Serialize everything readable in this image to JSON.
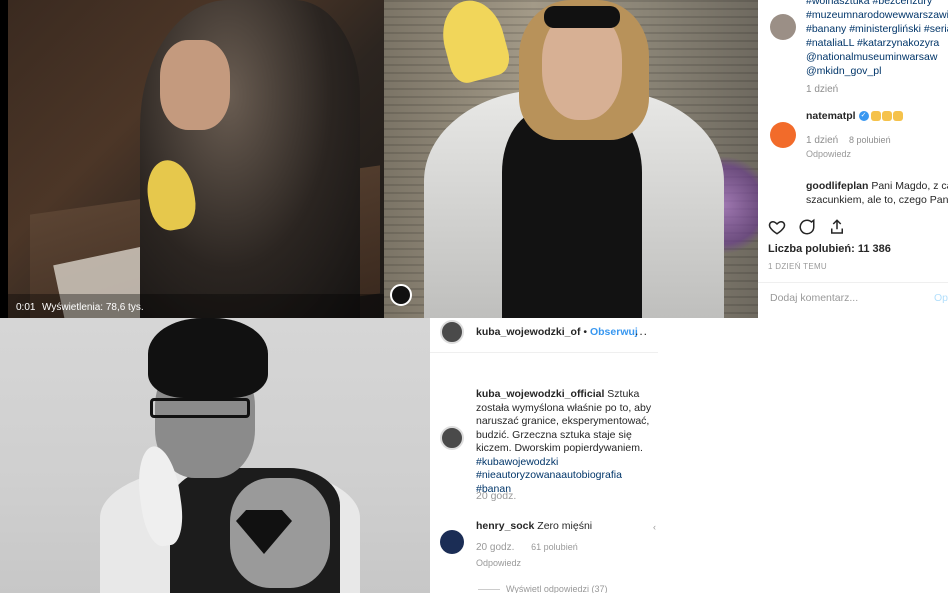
{
  "video": {
    "time": "0:01",
    "views": "Wyświetlenia: 78,6 tys."
  },
  "ig_top": {
    "hashtags": [
      "#wolnasztuka #bezcenzury",
      "#muzeumnarodowewwarszawie",
      "#banany #ministergliński #seria",
      "#nataliaLL #katarzynakozyra",
      "@nationalmuseuminwarsaw",
      "@mkidn_gov_pl"
    ],
    "time1": "1 dzień",
    "comment1_user": "natematpl",
    "comment1_time": "1 dzień",
    "comment1_likes": "8 polubień",
    "comment1_reply": "Odpowiedz",
    "comment2_user": "goodlifeplan",
    "comment2_text": "Pani Magdo, z ca",
    "comment2_text2": "szacunkiem, ale to, czego Pani",
    "likes": "Liczba polubień: 11 386",
    "ago": "1 DZIEŃ TEMU",
    "add_comment": "Dodaj komentarz...",
    "publish": "Op"
  },
  "ig_bottom": {
    "username": "kuba_wojewodzki_of",
    "separator": "•",
    "follow": "Obserwuj",
    "more": "...",
    "caption_user": "kuba_wojewodzki_official",
    "caption_text": "Sztuka została wymyślona właśnie po to, aby naruszać granice, eksperymentować, budzić. Grzeczna sztuka staje się kiczem. Dworskim popierdywaniem.",
    "tags": [
      "#kubawojewodzki",
      "#nieautoryzowanaautobiografia",
      "#banan"
    ],
    "time": "20 godz.",
    "comment_user": "henry_sock",
    "comment_text": "Zero mięśni",
    "comment_time": "20 godz.",
    "comment_likes": "61 polubień",
    "reply": "Odpowiedz",
    "view_replies": "Wyświetl odpowiedzi (37)",
    "heart": "‹"
  }
}
